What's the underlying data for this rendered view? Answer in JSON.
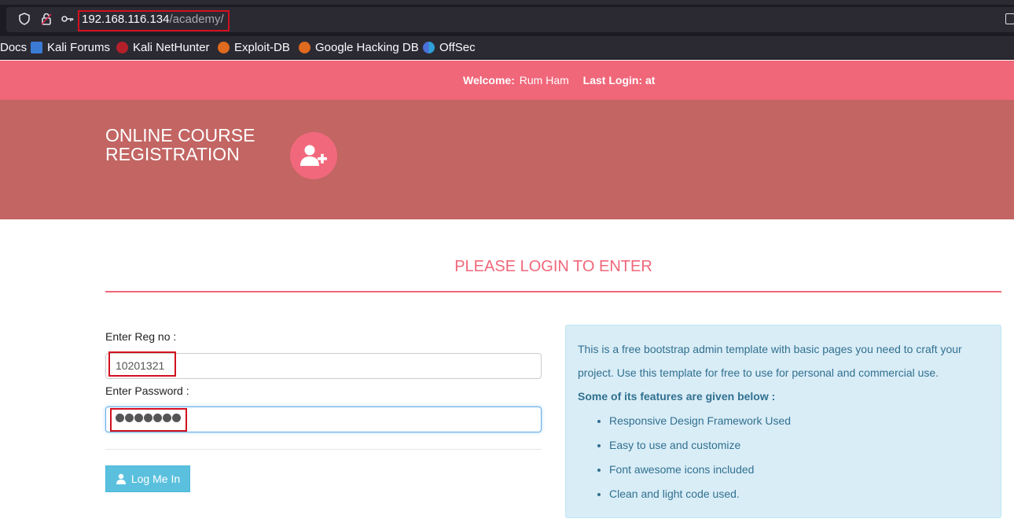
{
  "browser": {
    "url_host": "192.168.116.134",
    "url_path": "/academy/",
    "bookmarks": [
      {
        "label": "Docs",
        "icon": "doc-icon"
      },
      {
        "label": "Kali Forums",
        "icon": "kali-forums-icon"
      },
      {
        "label": "Kali NetHunter",
        "icon": "nethunter-icon"
      },
      {
        "label": "Exploit-DB",
        "icon": "exploitdb-icon"
      },
      {
        "label": "Google Hacking DB",
        "icon": "ghdb-icon"
      },
      {
        "label": "OffSec",
        "icon": "offsec-icon"
      }
    ]
  },
  "header": {
    "welcome_label": "Welcome:",
    "user_name": "Rum Ham",
    "last_login": "Last Login: at",
    "brand": "ONLINE COURSE REGISTRATION",
    "brand_icon": "user-plus-icon"
  },
  "login": {
    "heading": "PLEASE LOGIN TO ENTER",
    "reg_label": "Enter Reg no :",
    "reg_value": "10201321",
    "password_label": "Enter Password :",
    "password_length": 7,
    "button_label": "Log Me In",
    "button_icon": "user-icon"
  },
  "info": {
    "text": "This is a free bootstrap admin template with basic pages you need to craft your project. Use this template for free to use for personal and commercial use.",
    "features_title": "Some of its features are given below :",
    "features": [
      "Responsive Design Framework Used",
      "Easy to use and customize",
      "Font awesome icons included",
      "Clean and light code used."
    ]
  },
  "colors": {
    "accent": "#f0677a",
    "banner": "#c26563",
    "highlight": "#d2101e",
    "info_bg": "#d9edf7",
    "info_text": "#31708f"
  }
}
